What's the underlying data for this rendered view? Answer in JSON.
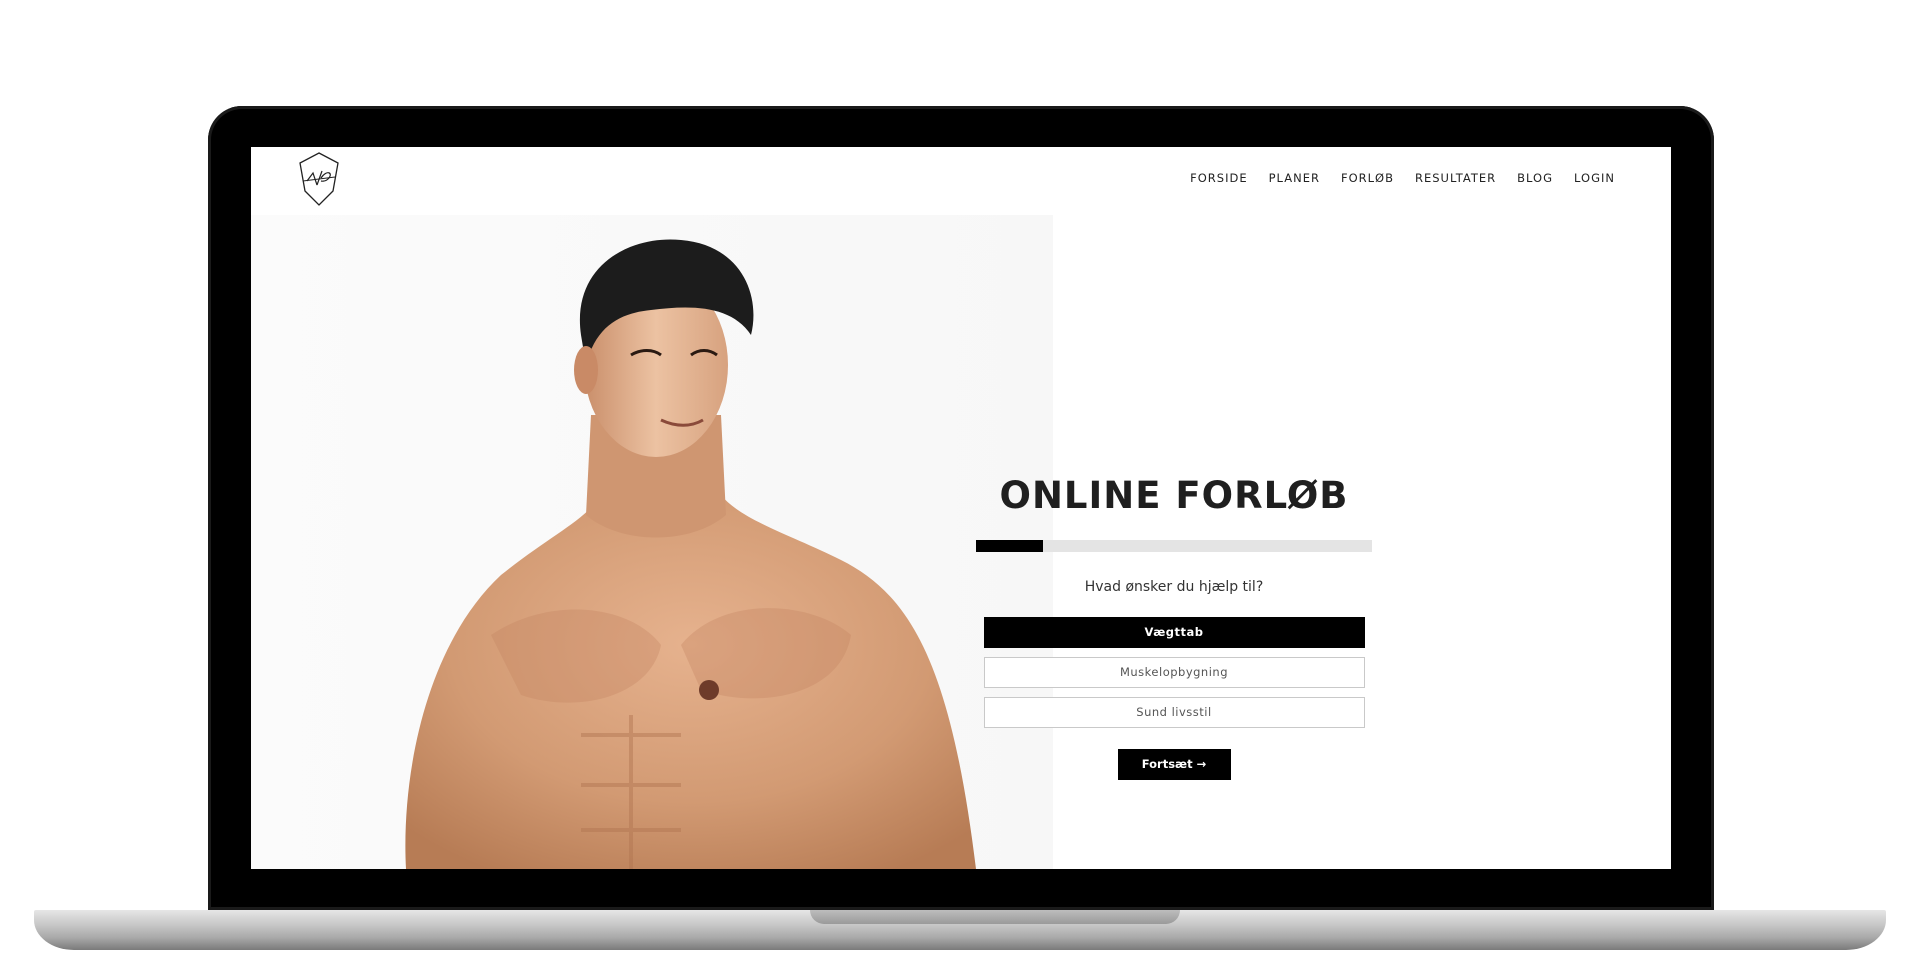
{
  "header": {
    "logo_icon": "vp-shield-logo-icon",
    "nav": [
      {
        "label": "FORSIDE"
      },
      {
        "label": "PLANER"
      },
      {
        "label": "FORLØB"
      },
      {
        "label": "RESULTATER"
      },
      {
        "label": "BLOG"
      },
      {
        "label": "LOGIN"
      }
    ]
  },
  "hero": {
    "image": "shirtless-man-photo"
  },
  "form": {
    "title": "ONLINE FORLØB",
    "progress": 0.17,
    "question": "Hvad ønsker du hjælp til?",
    "options": [
      {
        "label": "Vægttab",
        "selected": true
      },
      {
        "label": "Muskelopbygning",
        "selected": false
      },
      {
        "label": "Sund livsstil",
        "selected": false
      }
    ],
    "continue_label": "Fortsæt →"
  },
  "colors": {
    "accent": "#000000",
    "track": "#e4e4e4",
    "skin": "#d9a07a",
    "hair": "#1c1c1c"
  }
}
